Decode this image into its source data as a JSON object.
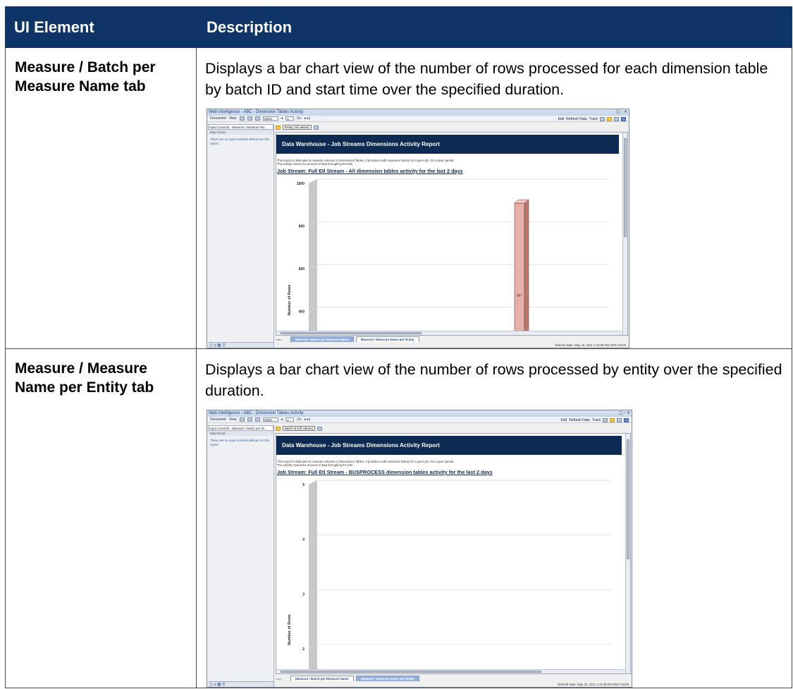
{
  "header": {
    "col1": "UI Element",
    "col2": "Description"
  },
  "rows": [
    {
      "element": "Measure / Batch per Measure Name tab",
      "description": "Displays a bar chart view of the number of rows processed for each dimension table by batch ID and start time over the specified duration.",
      "shot": {
        "window_title": "Web Intelligence - ABC - Dimension Tables Activity",
        "toolbar": {
          "document": "Document",
          "view": "View",
          "zoom": "100%",
          "page": "1",
          "page_total": "/1+",
          "edit": "Edit",
          "refresh": "Refresh Data",
          "track": "Track"
        },
        "input_controls_label": "Input Controls - Measure / Measure Na...",
        "panel_tabs": "Map   Reset",
        "panel_message": "There are no input controls defined on this report.",
        "filter_value": "Entity (All values)",
        "banner": "Data Warehouse - Job Streams Dimensions Activity Report",
        "note_line1": "This report is dedicated to measure volumes in Dimensions Tables. It provides Audit measures history for a given job, for a given period.",
        "note_line2": "The activity means the amount of data throughing the DW",
        "report_title": "Job Stream: Full Etl Stream -  All dimension tables activity for the last 2 days",
        "tab_active": "Measure / Batch per Measure Name",
        "tab_inactive": "Measure / Measure Name per Entity",
        "refresh_date": "Refresh Date: May 19, 2011 1:42:09 PM GMT+03:00",
        "footer_icons": "▯ ⫷ ▦ ⚲"
      },
      "chart_data": {
        "type": "bar",
        "ylabel": "Number of Rows",
        "yticks": [
          "1000",
          "800",
          "600",
          "400"
        ],
        "ylim": [
          300,
          1000
        ],
        "values": [
          907
        ],
        "labels": [
          "907"
        ],
        "color": "#e8b0a6"
      }
    },
    {
      "element": "Measure / Measure Name per Entity tab",
      "description": "Displays a bar chart view of the number of rows processed by entity over the specified duration.",
      "shot": {
        "window_title": "Web Intelligence - ABC - Dimension Tables Activity",
        "toolbar": {
          "document": "Document",
          "view": "View",
          "zoom": "100%",
          "page": "1",
          "page_total": "/1+",
          "edit": "Edit",
          "refresh": "Refresh Data",
          "track": "Track"
        },
        "input_controls_label": "Input Controls - Measure / Batch per M...",
        "panel_tabs": "Map   Reset",
        "panel_message": "There are no input controls defined on this report.",
        "filter_value": "Batch Id (All values)",
        "banner": "Data Warehouse - Job Streams Dimensions Activity Report",
        "note_line1": "This report is dedicated to measure volumes in Dimensions Tables. It provides Audit measures history for a given job, for a given period.",
        "note_line2": "The activity means the amount of data throughing the DW",
        "report_title": "Job Stream: Full Etl Stream -  BUSPROCESS dimension tables activity for the last 2 days",
        "tab_active": "Measure / Measure Name per Entity",
        "tab_inactive": "Measure / Batch per Measure Name",
        "refresh_date": "Refresh Date: May 19, 2011 1:42:09 PM GMT+03:00",
        "footer_icons": "▯ ⫷ ▦ ⚲"
      },
      "chart_data": {
        "type": "bar",
        "ylabel": "Number of Rows",
        "yticks": [
          "5",
          "4",
          "3",
          "2"
        ],
        "ylim": [
          1.6,
          5
        ],
        "values": [],
        "labels": []
      }
    }
  ]
}
